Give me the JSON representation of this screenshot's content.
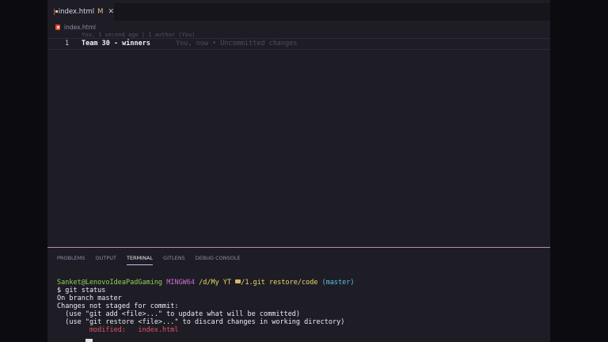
{
  "editor": {
    "tab": {
      "filename": "index.html",
      "status": "M",
      "close_glyph": "✕"
    },
    "breadcrumb": "index.html",
    "codelens": "You, 1 second ago | 1 author (You)",
    "lines": [
      {
        "number": "1",
        "code": "Team 30 - winners",
        "blame": "You, now • Uncommitted changes"
      }
    ]
  },
  "panel": {
    "tabs": [
      "PROBLEMS",
      "OUTPUT",
      "TERMINAL",
      "GITLENS",
      "DEBUG CONSOLE"
    ],
    "active_tab": "TERMINAL"
  },
  "terminal": {
    "prompt_user": "Sanket@LenovoIdeaPadGaming",
    "prompt_env": "MINGW64",
    "prompt_path_pre": "/d/My YT",
    "prompt_path_post": "/1.git restore/code",
    "prompt_branch": "(master)",
    "command": "$ git status",
    "out_branch": "On branch master",
    "out_changes": "Changes not staged for commit:",
    "out_hint1": "  (use \"git add <file>...\" to update what will be committed)",
    "out_hint2": "  (use \"git restore <file>...\" to discard changes in working directory)",
    "out_modified_label": "        modified:",
    "out_modified_file": "   index.html"
  },
  "colors": {
    "prompt_user": "#8bd450",
    "prompt_env": "#d16ad6",
    "prompt_path": "#e8d86a",
    "prompt_branch": "#59c2e6",
    "modified": "#e05561",
    "panel_border": "#b48ead"
  },
  "icons": {
    "tab": "html5-file-icon",
    "breadcrumb": "html5-file-icon",
    "path": "folder-icon"
  }
}
